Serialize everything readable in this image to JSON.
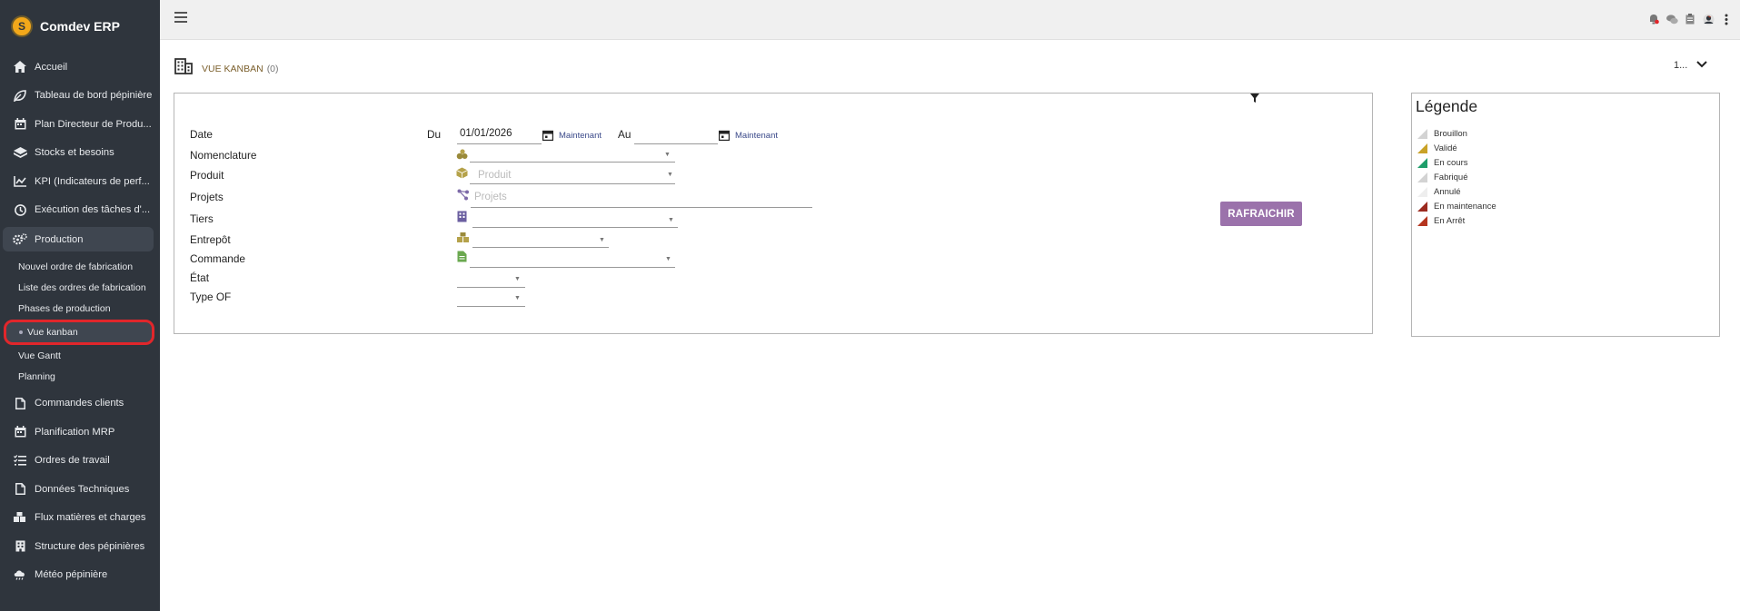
{
  "app": {
    "name": "Comdev ERP",
    "logo_text": "S"
  },
  "sidebar": {
    "items_top": [
      {
        "label": "Accueil",
        "icon": "home-icon"
      },
      {
        "label": "Tableau de bord pépinière",
        "icon": "leaf-icon"
      },
      {
        "label": "Plan Directeur de Produ...",
        "icon": "calendar-icon"
      },
      {
        "label": "Stocks et besoins",
        "icon": "boxes-icon"
      },
      {
        "label": "KPI (Indicateurs de perf...",
        "icon": "chart-line-icon"
      },
      {
        "label": "Exécution des tâches d'...",
        "icon": "clock-icon"
      }
    ],
    "active_item": {
      "label": "Production",
      "icon": "cogs-icon"
    },
    "sub_items": [
      {
        "label": "Nouvel ordre de fabrication"
      },
      {
        "label": "Liste des ordres de fabrication"
      },
      {
        "label": "Phases de production"
      },
      {
        "label": "Vue kanban",
        "current": true
      },
      {
        "label": "Vue Gantt"
      },
      {
        "label": "Planning"
      }
    ],
    "items_bottom": [
      {
        "label": "Commandes clients",
        "icon": "file-icon"
      },
      {
        "label": "Planification MRP",
        "icon": "calendar-icon"
      },
      {
        "label": "Ordres de travail",
        "icon": "tasks-icon"
      },
      {
        "label": "Données Techniques",
        "icon": "file-icon"
      },
      {
        "label": "Flux matières et charges",
        "icon": "boxes-icon"
      },
      {
        "label": "Structure des pépinières",
        "icon": "building-icon"
      },
      {
        "label": "Météo pépinière",
        "icon": "weather-icon"
      }
    ]
  },
  "header": {
    "title": "VUE KANBAN",
    "count": "(0)",
    "pager": "1..."
  },
  "filters": {
    "date_label": "Date",
    "from_label": "Du",
    "from_value": "01/01/2026",
    "now_label": "Maintenant",
    "to_label": "Au",
    "to_value": "",
    "nomenclature_label": "Nomenclature",
    "produit_label": "Produit",
    "produit_placeholder": "Produit",
    "projets_label": "Projets",
    "projets_placeholder": "Projets",
    "tiers_label": "Tiers",
    "entrepot_label": "Entrepôt",
    "commande_label": "Commande",
    "etat_label": "État",
    "type_of_label": "Type OF",
    "refresh_label": "RAFRAICHIR"
  },
  "legend": {
    "title": "Légende",
    "items": [
      {
        "label": "Brouillon",
        "color": "#d3d3d3"
      },
      {
        "label": "Validé",
        "color": "#c9a227"
      },
      {
        "label": "En cours",
        "color": "#1e9e6a"
      },
      {
        "label": "Fabriqué",
        "color": "#d3d3d3"
      },
      {
        "label": "Annulé",
        "color": "#eeeeee"
      },
      {
        "label": "En maintenance",
        "color": "#9b2a1f"
      },
      {
        "label": "En Arrêt",
        "color": "#b5351f"
      }
    ]
  },
  "colors": {
    "sidebar_bg": "#2f353d",
    "accent": "#9b72ab",
    "highlight": "#e1262b"
  }
}
